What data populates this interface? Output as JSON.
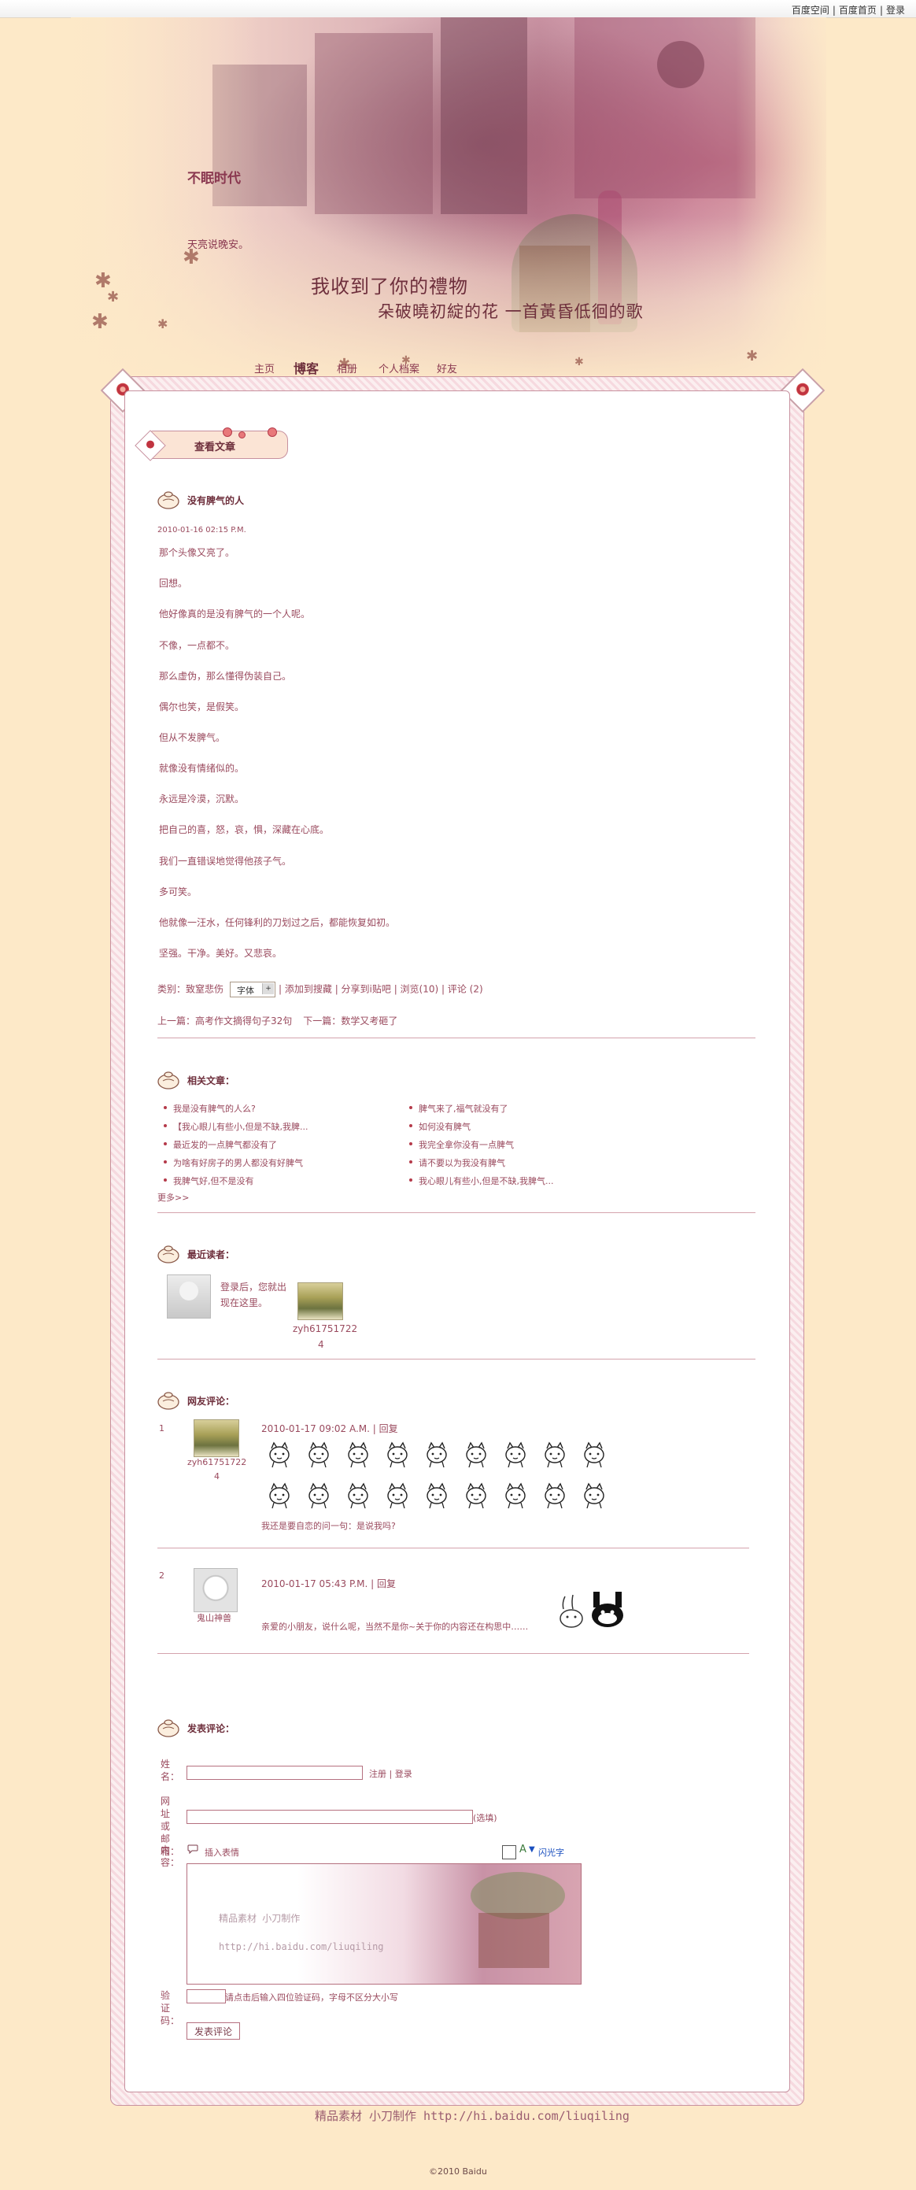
{
  "top_links": [
    "百度空间",
    "百度首页",
    "登录"
  ],
  "blog": {
    "title": "不眠时代",
    "description": "天亮说晚安。",
    "slogan_line1": "我收到了你的禮物",
    "slogan_line2": "朵破曉初綻的花 一首黃昏低徊的歌"
  },
  "nav": [
    "主页",
    "博客",
    "相册",
    "个人档案",
    "好友"
  ],
  "page_heading": "查看文章",
  "article": {
    "title": "没有脾气的人",
    "date": "2010-01-16 02:15 P.M.",
    "paragraphs": [
      "那个头像又亮了。",
      "回想。",
      "他好像真的是没有脾气的一个人呢。",
      "不像，一点都不。",
      "那么虚伪，那么懂得伪装自己。",
      "偶尔也笑，是假笑。",
      "但从不发脾气。",
      "就像没有情绪似的。",
      "永远是冷漠，沉默。",
      "把自己的喜，怒，哀，惧，深藏在心底。",
      "我们一直错误地觉得他孩子气。",
      "多可笑。",
      "他就像一汪水，任何锋利的刀划过之后，都能恢复如初。",
      "坚强。干净。美好。又悲哀。"
    ],
    "category_label": "类别：致窒悲伤",
    "font_select": "字体",
    "font_button": "+",
    "actions": "| 添加到搜藏 | 分享到i贴吧 | 浏览(10) | 评论 (2)",
    "prev_label": "上一篇：",
    "prev_title": "高考作文摘得句子32句",
    "next_label": "下一篇：",
    "next_title": "数学又考砸了"
  },
  "related": {
    "heading": "相关文章：",
    "left": [
      "我是没有脾气的人么?",
      "【我心眼儿有些小,但是不缺,我脾...",
      "最近发的一点脾气都没有了",
      "为啥有好房子的男人都没有好脾气",
      "我脾气好,但不是没有"
    ],
    "right": [
      "脾气来了,福气就没有了",
      "如何没有脾气",
      "我完全拿你没有一点脾气",
      "请不要以为我没有脾气",
      "我心眼儿有些小,但是不缺,我脾气..."
    ],
    "more": "更多>>"
  },
  "readers": {
    "heading": "最近读者：",
    "login_hint_line1": "登录后，您就出",
    "login_hint_line2": "现在这里。",
    "reader_name": "zyh61751722",
    "reader_count": "4"
  },
  "comments": {
    "heading": "网友评论：",
    "items": [
      {
        "num": "1",
        "user": "zyh61751722",
        "user_count": "4",
        "time": "2010-01-17 09:02 A.M.",
        "reply": "回复",
        "text": "我还是要自恋的问一句：是说我吗?"
      },
      {
        "num": "2",
        "user": "鬼山神兽",
        "time": "2010-01-17 05:43 P.M.",
        "reply": "回复",
        "text": "亲爱的小朋友，说什么呢，当然不是你~关于你的内容还在构思中……"
      }
    ]
  },
  "form": {
    "heading": "发表评论：",
    "name_label": "姓名：",
    "register": "注册",
    "login": "登录",
    "url_label": "网址或邮箱：",
    "optional": "(选填)",
    "content_label": "内容：",
    "insert_emoticon": "插入表情",
    "flash_text": "闪光字",
    "captcha_label": "验证码：",
    "captcha_hint": "请点击后输入四位验证码，字母不区分大小写",
    "submit": "发表评论",
    "editor_line1": "精品素材 小刀制作",
    "editor_line2": "http://hi.baidu.com/liuqiling"
  },
  "footer": {
    "signature": "精品素材  小刀制作   http://hi.baidu.com/liuqiling",
    "copyright": "©2010 Baidu"
  }
}
